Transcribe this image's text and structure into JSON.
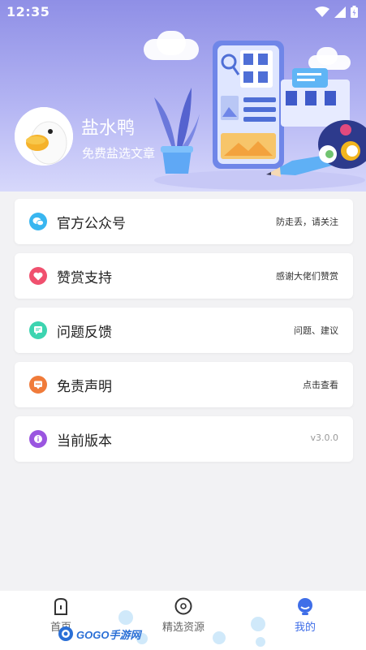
{
  "status": {
    "time": "12:35"
  },
  "profile": {
    "name": "盐水鸭",
    "subtitle": "免费盐选文章"
  },
  "menu": [
    {
      "label": "官方公众号",
      "value": "防走丢，请关注",
      "icon": "wechat-icon",
      "color": "#39b6f0"
    },
    {
      "label": "赞赏支持",
      "value": "感谢大佬们赞赏",
      "icon": "heart-icon",
      "color": "#f0506e"
    },
    {
      "label": "问题反馈",
      "value": "问题、建议",
      "icon": "feedback-icon",
      "color": "#3dd4b0"
    },
    {
      "label": "免责声明",
      "value": "点击查看",
      "icon": "message-icon",
      "color": "#f07b3a"
    },
    {
      "label": "当前版本",
      "value": "v3.0.0",
      "icon": "info-icon",
      "color": "#9a55e0"
    }
  ],
  "tabs": [
    {
      "label": "首页",
      "icon": "home-icon"
    },
    {
      "label": "精选资源",
      "icon": "compass-icon"
    },
    {
      "label": "我的",
      "icon": "profile-icon",
      "active": true
    }
  ],
  "watermark": "GOGO手游网",
  "colors": {
    "accent": "#3f6ee8",
    "header_top": "#8f8fe6",
    "header_bottom": "#d7d8fb"
  }
}
